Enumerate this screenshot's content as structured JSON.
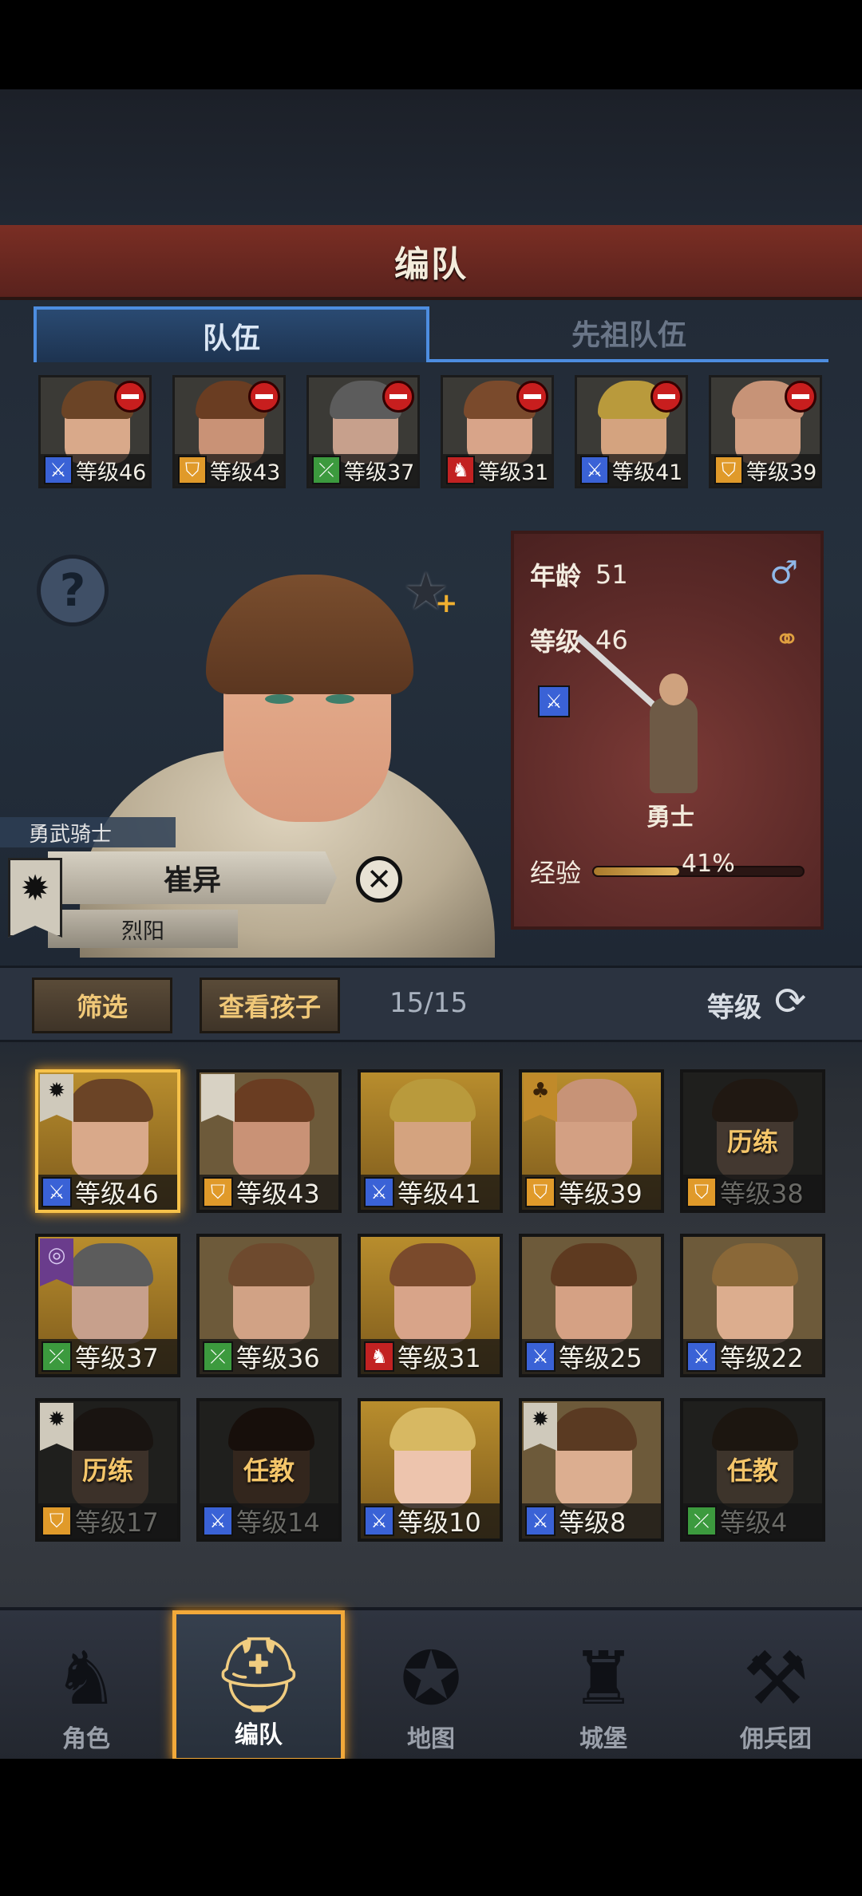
{
  "header": {
    "title": "编队"
  },
  "tabs": [
    {
      "label": "队伍",
      "active": true
    },
    {
      "label": "先祖队伍",
      "active": false
    }
  ],
  "team": [
    {
      "class": "sword",
      "level_text": "等级46",
      "skin": "#d9a98a",
      "hair": "#6b4426"
    },
    {
      "class": "shield",
      "level_text": "等级43",
      "skin": "#c99276",
      "hair": "#6a3d22"
    },
    {
      "class": "bow",
      "level_text": "等级37",
      "skin": "#c7a08c",
      "hair": "#5c5c5c"
    },
    {
      "class": "horse",
      "level_text": "等级31",
      "skin": "#d8a489",
      "hair": "#7a4a2c"
    },
    {
      "class": "sword",
      "level_text": "等级41",
      "skin": "#d4a37f",
      "hair": "#b99a3c"
    },
    {
      "class": "shield",
      "level_text": "等级39",
      "skin": "#d3a083",
      "hair": "#c79377"
    }
  ],
  "hero": {
    "title": "勇武骑士",
    "name": "崔异",
    "epithet": "烈阳",
    "age_label": "年龄",
    "age": "51",
    "level_label": "等级",
    "level": "46",
    "unit_name": "勇士",
    "exp_label": "经验",
    "exp_percent_text": "41%",
    "exp_fraction": 0.41
  },
  "filter_bar": {
    "filter_label": "筛选",
    "children_label": "查看孩子",
    "count": "15/15",
    "sort_label": "等级"
  },
  "roster": [
    {
      "class": "sword",
      "level_text": "等级46",
      "bg": "gold",
      "selected": true,
      "status": "",
      "badge": "sun",
      "skin": "#d9a98a",
      "hair": "#6b4426"
    },
    {
      "class": "shield",
      "level_text": "等级43",
      "bg": "brown",
      "selected": false,
      "status": "",
      "badge": "banner",
      "skin": "#c99276",
      "hair": "#6a3d22"
    },
    {
      "class": "sword",
      "level_text": "等级41",
      "bg": "gold",
      "selected": false,
      "status": "",
      "badge": "",
      "skin": "#d4a37f",
      "hair": "#b99a3c"
    },
    {
      "class": "shield",
      "level_text": "等级39",
      "bg": "gold",
      "selected": false,
      "status": "",
      "badge": "tree",
      "skin": "#d3a083",
      "hair": "#c79377"
    },
    {
      "class": "shield",
      "level_text": "等级38",
      "bg": "dim",
      "selected": false,
      "status": "历练",
      "badge": "",
      "skin": "#7a6658",
      "hair": "#3b2c22"
    },
    {
      "class": "bow",
      "level_text": "等级37",
      "bg": "gold",
      "selected": false,
      "status": "",
      "badge": "purple",
      "skin": "#c7a08c",
      "hair": "#5c5c5c"
    },
    {
      "class": "bow",
      "level_text": "等级36",
      "bg": "brown",
      "selected": false,
      "status": "",
      "badge": "",
      "skin": "#d1a285",
      "hair": "#6e4a2e"
    },
    {
      "class": "horse",
      "level_text": "等级31",
      "bg": "gold",
      "selected": false,
      "status": "",
      "badge": "",
      "skin": "#d8a489",
      "hair": "#7a4a2c"
    },
    {
      "class": "sword",
      "level_text": "等级25",
      "bg": "brown",
      "selected": false,
      "status": "",
      "badge": "",
      "skin": "#d5a184",
      "hair": "#5e3a20"
    },
    {
      "class": "sword",
      "level_text": "等级22",
      "bg": "brown",
      "selected": false,
      "status": "",
      "badge": "",
      "skin": "#dcad8e",
      "hair": "#8a6838"
    },
    {
      "class": "shield",
      "level_text": "等级17",
      "bg": "dim",
      "selected": false,
      "status": "历练",
      "badge": "sun",
      "skin": "#6e5a4c",
      "hair": "#2e2620"
    },
    {
      "class": "sword",
      "level_text": "等级14",
      "bg": "dim",
      "selected": false,
      "status": "任教",
      "badge": "",
      "skin": "#5e4636",
      "hair": "#2a1c14"
    },
    {
      "class": "sword",
      "level_text": "等级10",
      "bg": "gold",
      "selected": false,
      "status": "",
      "badge": "",
      "skin": "#edc4ad",
      "hair": "#d7b862"
    },
    {
      "class": "sword",
      "level_text": "等级8",
      "bg": "brown",
      "selected": false,
      "status": "",
      "badge": "sun",
      "skin": "#dcae90",
      "hair": "#5a3a22"
    },
    {
      "class": "bow",
      "level_text": "等级4",
      "bg": "dim",
      "selected": false,
      "status": "任教",
      "badge": "",
      "skin": "#70604f",
      "hair": "#33281e"
    }
  ],
  "nav": [
    {
      "label": "角色",
      "icon": "knight-icon",
      "active": false
    },
    {
      "label": "编队",
      "icon": "helmet-icon",
      "active": true
    },
    {
      "label": "地图",
      "icon": "compass-icon",
      "active": false
    },
    {
      "label": "城堡",
      "icon": "castle-icon",
      "active": false
    },
    {
      "label": "佣兵团",
      "icon": "mercenary-icon",
      "active": false
    }
  ],
  "colors": {
    "banner_red": "#7a2e24",
    "tab_blue": "#4d8de0",
    "selected_gold": "#f6c24a",
    "remove_red": "#c81e1e"
  }
}
